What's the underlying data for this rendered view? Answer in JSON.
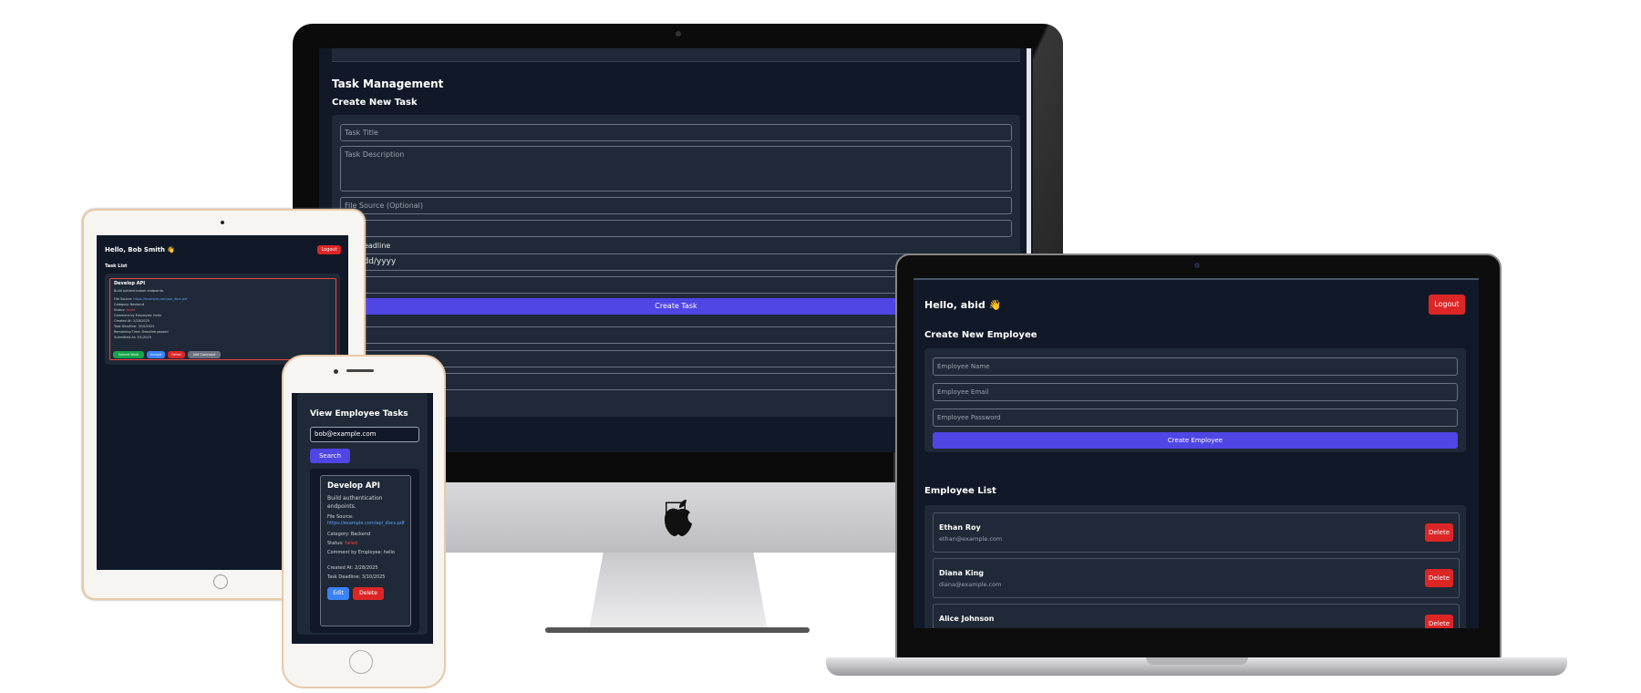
{
  "imac": {
    "section_title": "Task Management",
    "form_title": "Create New Task",
    "task_title_placeholder": "Task Title",
    "task_description_placeholder": "Task Description",
    "file_source_placeholder": "File Source (Optional)",
    "deadline_label": "Task Deadline",
    "date_placeholder": "mm/dd/yyyy",
    "create_button": "Create Task"
  },
  "laptop": {
    "greeting": "Hello, abid 👋",
    "logout": "Logout",
    "form_title": "Create New Employee",
    "name_placeholder": "Employee Name",
    "email_placeholder": "Employee Email",
    "password_placeholder": "Employee Password",
    "create_button": "Create Employee",
    "list_title": "Employee List",
    "delete_label": "Delete",
    "employees": [
      {
        "name": "Ethan Roy",
        "email": "ethan@example.com"
      },
      {
        "name": "Diana King",
        "email": "diana@example.com"
      },
      {
        "name": "Alice Johnson",
        "email": ""
      }
    ]
  },
  "ipad": {
    "greeting": "Hello, Bob Smith 👋",
    "logout": "Logout",
    "list_title": "Task List",
    "task": {
      "title": "Develop API",
      "description": "Build authentication endpoints.",
      "file_label": "File Source:",
      "file_url": "https://example.com/api_docs.pdf",
      "category": "Category: Backend",
      "status_label": "Status:",
      "status_value": "failed",
      "comment": "Comment by Employee: hello",
      "created": "Created At: 2/28/2025",
      "deadline": "Task Deadline: 3/10/2025",
      "remaining": "Remaining Time: Deadline passed",
      "submitted": "Submitted At: 3/1/2025"
    },
    "buttons": [
      "Submit Work",
      "Accept",
      "Failed",
      "Add Comment"
    ]
  },
  "iphone": {
    "title": "View Employee Tasks",
    "search_value": "bob@example.com",
    "search_button": "Search",
    "task": {
      "title": "Develop API",
      "description": "Build authentication endpoints.",
      "file_label": "File Source:",
      "file_url": "https://example.com/api_docs.pdf",
      "category": "Category: Backend",
      "status_label": "Status:",
      "status_value": "failed",
      "comment": "Comment by Employee: hello",
      "created": "Created At: 2/28/2025",
      "deadline": "Task Deadline: 3/10/2025"
    },
    "edit": "Edit",
    "delete": "Delete"
  }
}
